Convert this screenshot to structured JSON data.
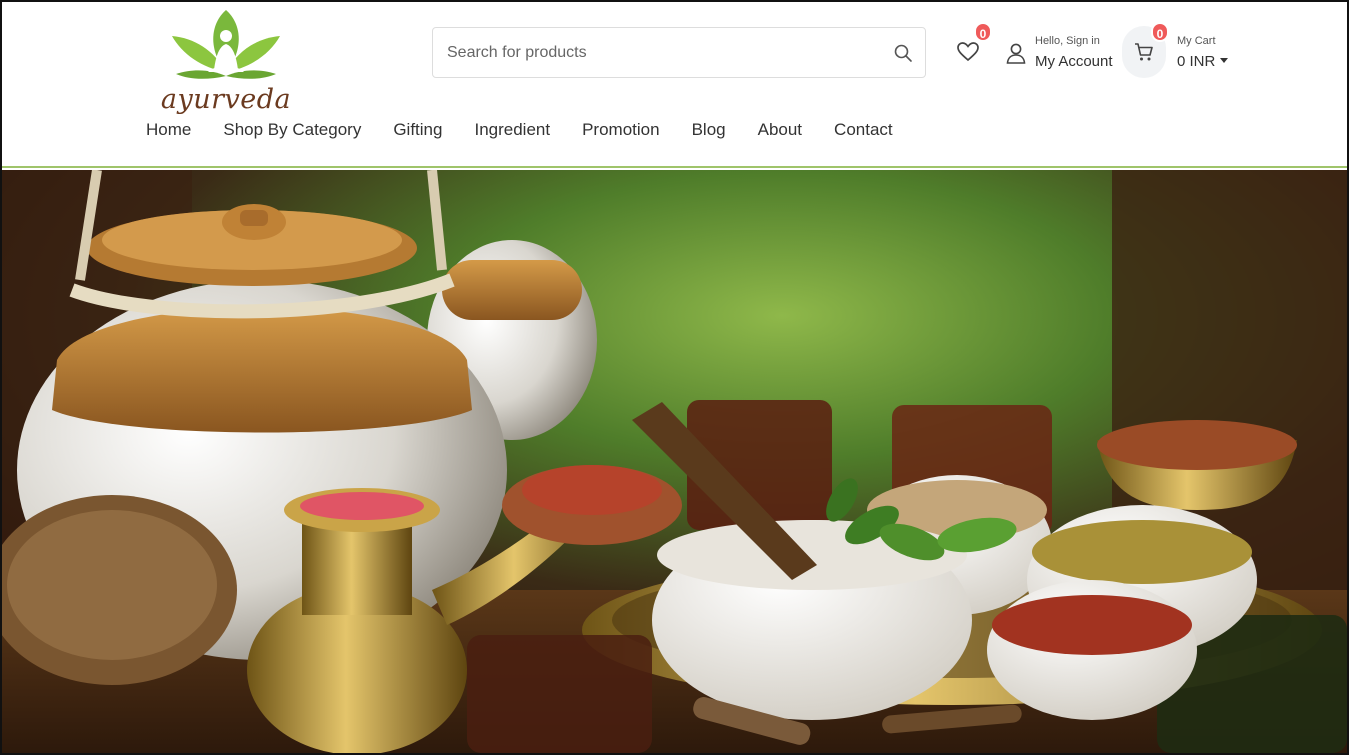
{
  "brand": {
    "logo_text": "ayurveda"
  },
  "search": {
    "placeholder": "Search for products"
  },
  "wishlist": {
    "count": "0"
  },
  "account": {
    "greeting": "Hello, Sign in",
    "label": "My Account"
  },
  "cart": {
    "label": "My Cart",
    "count": "0",
    "total": "0 INR"
  },
  "nav": {
    "items": [
      {
        "label": "Home"
      },
      {
        "label": "Shop By Category"
      },
      {
        "label": "Gifting"
      },
      {
        "label": "Ingredient"
      },
      {
        "label": "Promotion"
      },
      {
        "label": "Blog"
      },
      {
        "label": "About"
      },
      {
        "label": "Contact"
      }
    ]
  },
  "colors": {
    "accent": "#8cc63f",
    "badge": "#ef5a5a",
    "brand_text": "#6b3a1f"
  },
  "icons": [
    "search-icon",
    "heart-icon",
    "user-icon",
    "cart-icon",
    "caret-down-icon"
  ]
}
